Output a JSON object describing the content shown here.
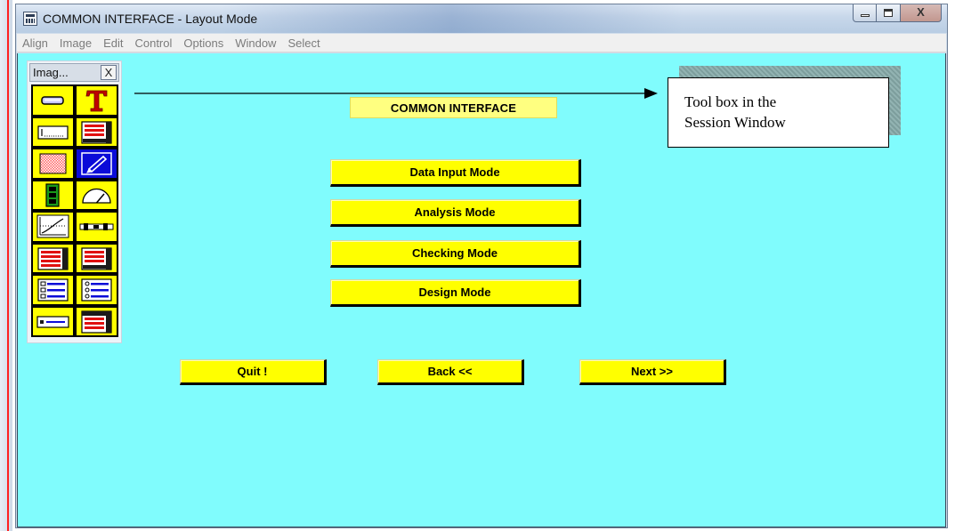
{
  "window": {
    "title": "COMMON INTERFACE - Layout Mode",
    "controls": {
      "minimize": "minimize",
      "maximize": "maximize",
      "close": "X"
    }
  },
  "menubar": {
    "items": [
      "Align",
      "Image",
      "Edit",
      "Control",
      "Options",
      "Window",
      "Select"
    ]
  },
  "toolbox": {
    "title": "Imag...",
    "close_label": "X",
    "tools": [
      "field-tool-icon",
      "text-tool-icon",
      "input-field-tool-icon",
      "list-window-tool-icon",
      "pattern-tool-icon",
      "pen-tool-icon",
      "traffic-light-tool-icon",
      "gauge-tool-icon",
      "graph-tool-icon",
      "slider-tool-icon",
      "bar-list-tool-icon",
      "bar-list-alt-tool-icon",
      "list-box-tool-icon",
      "checklist-tool-icon",
      "button-tool-icon",
      "table-window-tool-icon"
    ],
    "selected_tool": "pen-tool-icon"
  },
  "design": {
    "title": "COMMON INTERFACE",
    "modes": [
      "Data Input Mode",
      "Analysis Mode",
      "Checking Mode",
      "Design Mode"
    ],
    "nav": {
      "quit": "Quit !",
      "back": "Back <<",
      "next": "Next >>"
    }
  },
  "annotation": {
    "line1": "Tool box in the",
    "line2": "Session Window"
  },
  "colors": {
    "canvas": "#80fcfd",
    "button": "#ffff00",
    "title_label": "#ffff80",
    "tool_selected": "#0b0bd8"
  }
}
